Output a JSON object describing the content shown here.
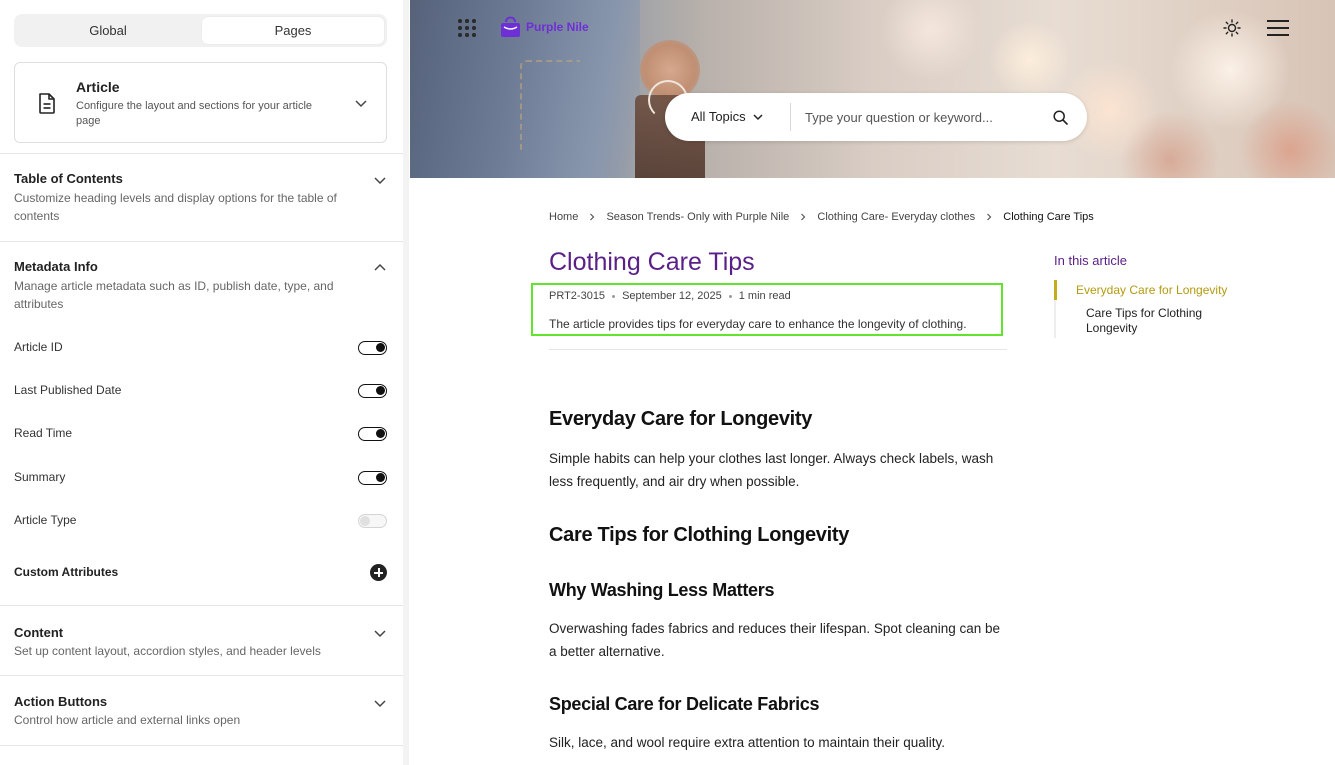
{
  "sidebar": {
    "tabs": {
      "global": "Global",
      "pages": "Pages",
      "active": "Pages"
    },
    "page_selector": {
      "title": "Article",
      "subtitle": "Configure the layout and sections for your article page"
    },
    "sections": {
      "toc": {
        "title": "Table of Contents",
        "subtitle": "Customize heading levels and display options for the table of contents",
        "expanded": false
      },
      "metadata": {
        "title": "Metadata Info",
        "subtitle": "Manage article metadata such as ID, publish date, type, and attributes",
        "expanded": true
      },
      "content": {
        "title": "Content",
        "subtitle": "Set up content layout, accordion styles, and header levels",
        "expanded": false
      },
      "actions": {
        "title": "Action Buttons",
        "subtitle": "Control how article and external links open",
        "expanded": false
      }
    },
    "toggles": [
      {
        "label": "Article ID",
        "on": true
      },
      {
        "label": "Last Published Date",
        "on": true
      },
      {
        "label": "Read Time",
        "on": true
      },
      {
        "label": "Summary",
        "on": true
      },
      {
        "label": "Article Type",
        "on": false
      }
    ],
    "custom_attributes_label": "Custom Attributes"
  },
  "preview": {
    "brand": {
      "name": "Purple Nile",
      "color": "#6f2fd6"
    },
    "search": {
      "topic": "All Topics",
      "placeholder": "Type your question or keyword..."
    },
    "breadcrumb": [
      "Home",
      "Season Trends- Only with Purple Nile",
      "Clothing Care- Everyday clothes",
      "Clothing Care Tips"
    ],
    "article": {
      "title": "Clothing Care Tips",
      "id": "PRT2-3015",
      "date": "September 12, 2025",
      "read_time": "1 min read",
      "summary": "The article provides tips for everyday care to enhance the longevity of clothing.",
      "sections": [
        {
          "heading": "Everyday Care for Longevity",
          "body": "Simple habits can help your clothes last longer. Always check labels, wash less frequently, and air dry when possible."
        },
        {
          "heading": "Care Tips for Clothing Longevity"
        },
        {
          "heading": "Why Washing Less Matters",
          "body": "Overwashing fades fabrics and reduces their lifespan. Spot cleaning can be a better alternative."
        },
        {
          "heading": "Special Care for Delicate Fabrics",
          "body": "Silk, lace, and wool require extra attention to maintain their quality."
        }
      ]
    },
    "toc": {
      "heading": "In this article",
      "items": [
        "Everyday Care for Longevity",
        "Care Tips for Clothing Longevity"
      ],
      "active_index": 0
    },
    "colors": {
      "title": "#5a1f88",
      "toc_active": "#b39a10",
      "highlight": "#62e42d"
    }
  }
}
